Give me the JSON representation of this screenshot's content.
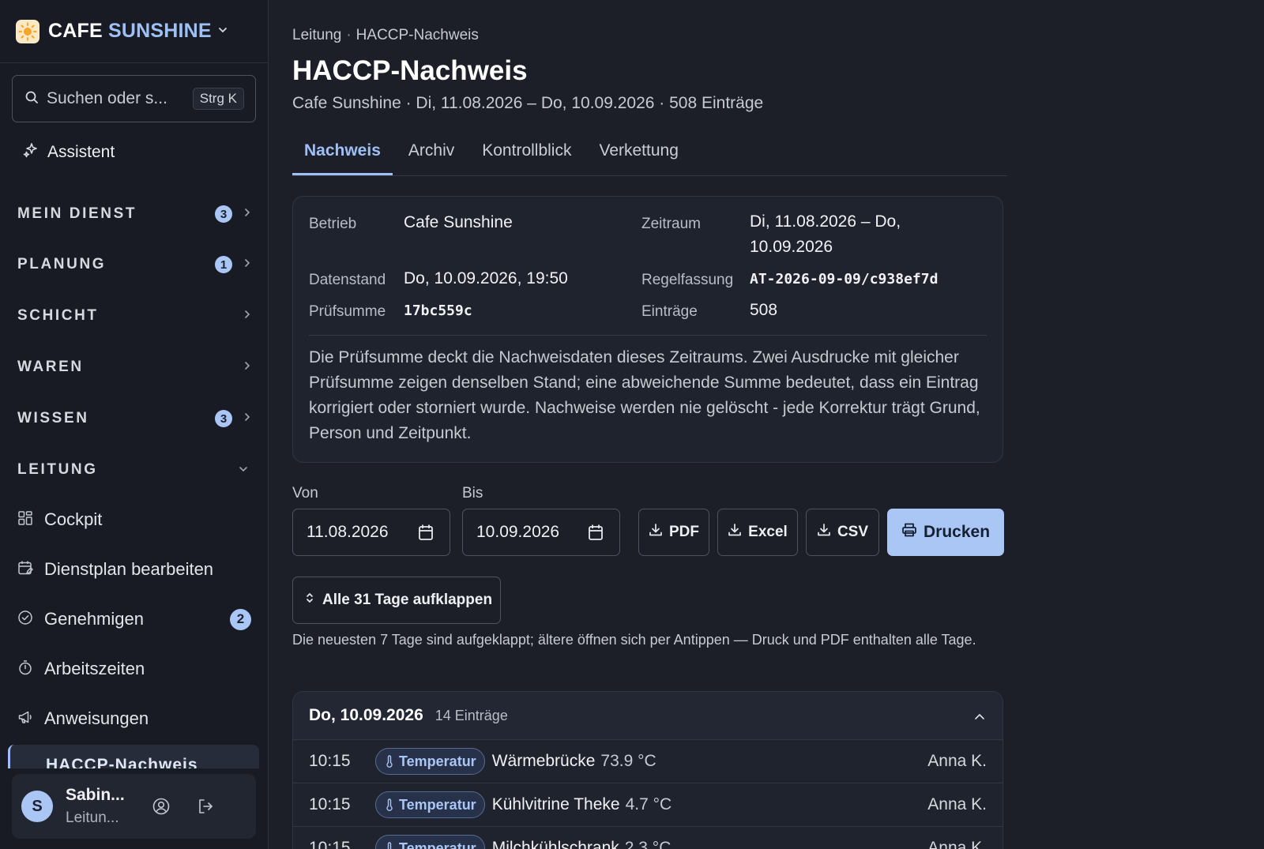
{
  "brand": {
    "name_primary": "CAFE",
    "name_accent": "SUNSHINE",
    "logo_icon": "sun-icon"
  },
  "search": {
    "placeholder": "Suchen oder s...",
    "shortcut": "Strg K"
  },
  "assistant": {
    "label": "Assistent"
  },
  "sidebar": {
    "sections": [
      {
        "label": "MEIN DIENST",
        "badge": "3",
        "state": "collapsed"
      },
      {
        "label": "PLANUNG",
        "badge": "1",
        "state": "collapsed"
      },
      {
        "label": "SCHICHT",
        "badge": "",
        "state": "collapsed"
      },
      {
        "label": "WAREN",
        "badge": "",
        "state": "collapsed"
      },
      {
        "label": "WISSEN",
        "badge": "3",
        "state": "collapsed"
      },
      {
        "label": "LEITUNG",
        "badge": "",
        "state": "expanded"
      }
    ],
    "items": [
      {
        "label": "Cockpit",
        "icon": "grid-icon",
        "badge": ""
      },
      {
        "label": "Dienstplan bearbeiten",
        "icon": "calendar-edit-icon",
        "badge": ""
      },
      {
        "label": "Genehmigen",
        "icon": "check-circle-icon",
        "badge": "2"
      },
      {
        "label": "Arbeitszeiten",
        "icon": "stopwatch-icon",
        "badge": ""
      },
      {
        "label": "Anweisungen",
        "icon": "megaphone-icon",
        "badge": ""
      },
      {
        "label": "HACCP-Nachweis",
        "icon": "shield-icon",
        "badge": ""
      }
    ]
  },
  "user": {
    "initial": "S",
    "name": "Sabin...",
    "role": "Leitun..."
  },
  "header": {
    "breadcrumb": [
      "Leitung",
      "HACCP-Nachweis"
    ],
    "title": "HACCP-Nachweis",
    "subtitle": "Cafe Sunshine · Di, 11.08.2026 – Do, 10.09.2026 · 508 Einträge"
  },
  "tabs": [
    {
      "label": "Nachweis",
      "active": true
    },
    {
      "label": "Archiv",
      "active": false
    },
    {
      "label": "Kontrollblick",
      "active": false
    },
    {
      "label": "Verkettung",
      "active": false
    }
  ],
  "info": {
    "betrieb_label": "Betrieb",
    "betrieb": "Cafe Sunshine",
    "zeitraum_label": "Zeitraum",
    "zeitraum": "Di, 11.08.2026 – Do, 10.09.2026",
    "datenstand_label": "Datenstand",
    "datenstand": "Do, 10.09.2026, 19:50",
    "regelfassung_label": "Regelfassung",
    "regelfassung": "AT-2026-09-09/c938ef7d",
    "pruefsumme_label": "Prüfsumme",
    "pruefsumme": "17bc559c",
    "eintraege_label": "Einträge",
    "eintraege": "508",
    "note": "Die Prüfsumme deckt die Nachweisdaten dieses Zeitraums. Zwei Ausdrucke mit gleicher Prüfsumme zeigen denselben Stand; eine abweichende Summe bedeutet, dass ein Eintrag korrigiert oder storniert wurde. Nachweise werden nie gelöscht - jede Korrektur trägt Grund, Person und Zeitpunkt."
  },
  "filters": {
    "von_label": "Von",
    "von": "11.08.2026",
    "bis_label": "Bis",
    "bis": "10.09.2026"
  },
  "actions": {
    "pdf": "PDF",
    "excel": "Excel",
    "csv": "CSV",
    "print": "Drucken"
  },
  "expand": {
    "label": "Alle 31 Tage aufklappen",
    "hint": "Die neuesten 7 Tage sind aufgeklappt; ältere öffnen sich per Antippen — Druck und PDF enthalten alle Tage."
  },
  "day": {
    "date": "Do, 10.09.2026",
    "count": "14 Einträge",
    "entries": [
      {
        "time": "10:15",
        "tag": "Temperatur",
        "name": "Wärmebrücke",
        "value": "73.9 °C",
        "user": "Anna K."
      },
      {
        "time": "10:15",
        "tag": "Temperatur",
        "name": "Kühlvitrine Theke",
        "value": "4.7 °C",
        "user": "Anna K."
      },
      {
        "time": "10:15",
        "tag": "Temperatur",
        "name": "Milchkühlschrank",
        "value": "2.3 °C",
        "user": "Anna K."
      }
    ]
  },
  "colors": {
    "accent": "#9ec0f7",
    "primary_button": "#a9c6f5",
    "background": "#1c1f28",
    "sidebar": "#181b23"
  }
}
